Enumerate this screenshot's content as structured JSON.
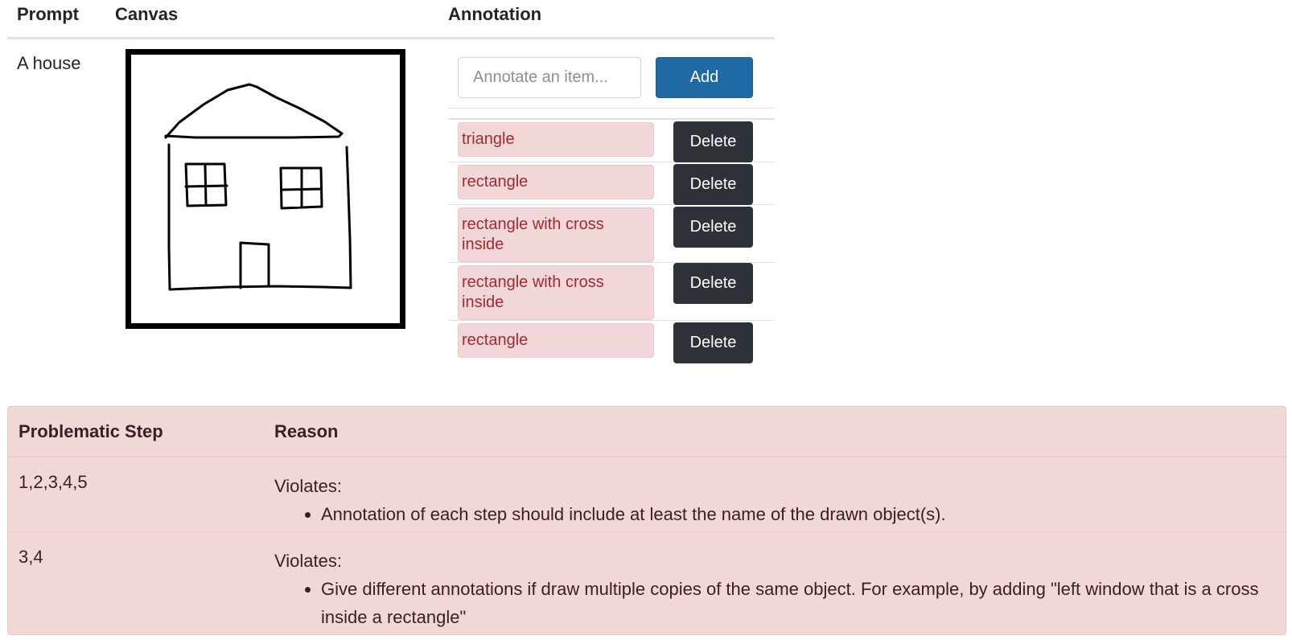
{
  "header": {
    "prompt": "Prompt",
    "canvas": "Canvas",
    "annotation": "Annotation"
  },
  "row": {
    "prompt": "A house"
  },
  "annotation": {
    "input_placeholder": "Annotate an item...",
    "input_value": "",
    "add_label": "Add",
    "delete_label": "Delete",
    "items": [
      "triangle",
      "rectangle",
      "rectangle with cross inside",
      "rectangle with cross inside",
      "rectangle"
    ]
  },
  "feedback": {
    "header_step": "Problematic Step",
    "header_reason": "Reason",
    "rows": [
      {
        "steps": "1,2,3,4,5",
        "violates": "Violates:",
        "bullet": "Annotation of each step should include at least the name of the drawn object(s)."
      },
      {
        "steps": "3,4",
        "violates": "Violates:",
        "bullet": "Give different annotations if draw multiple copies of the same object. For example, by adding \"left window that is a cross inside a rectangle\""
      }
    ]
  },
  "colors": {
    "add_button": "#1f6aa5",
    "delete_button": "#2d3238",
    "danger_bg": "#f2d7d9",
    "danger_text": "#a22a32"
  }
}
